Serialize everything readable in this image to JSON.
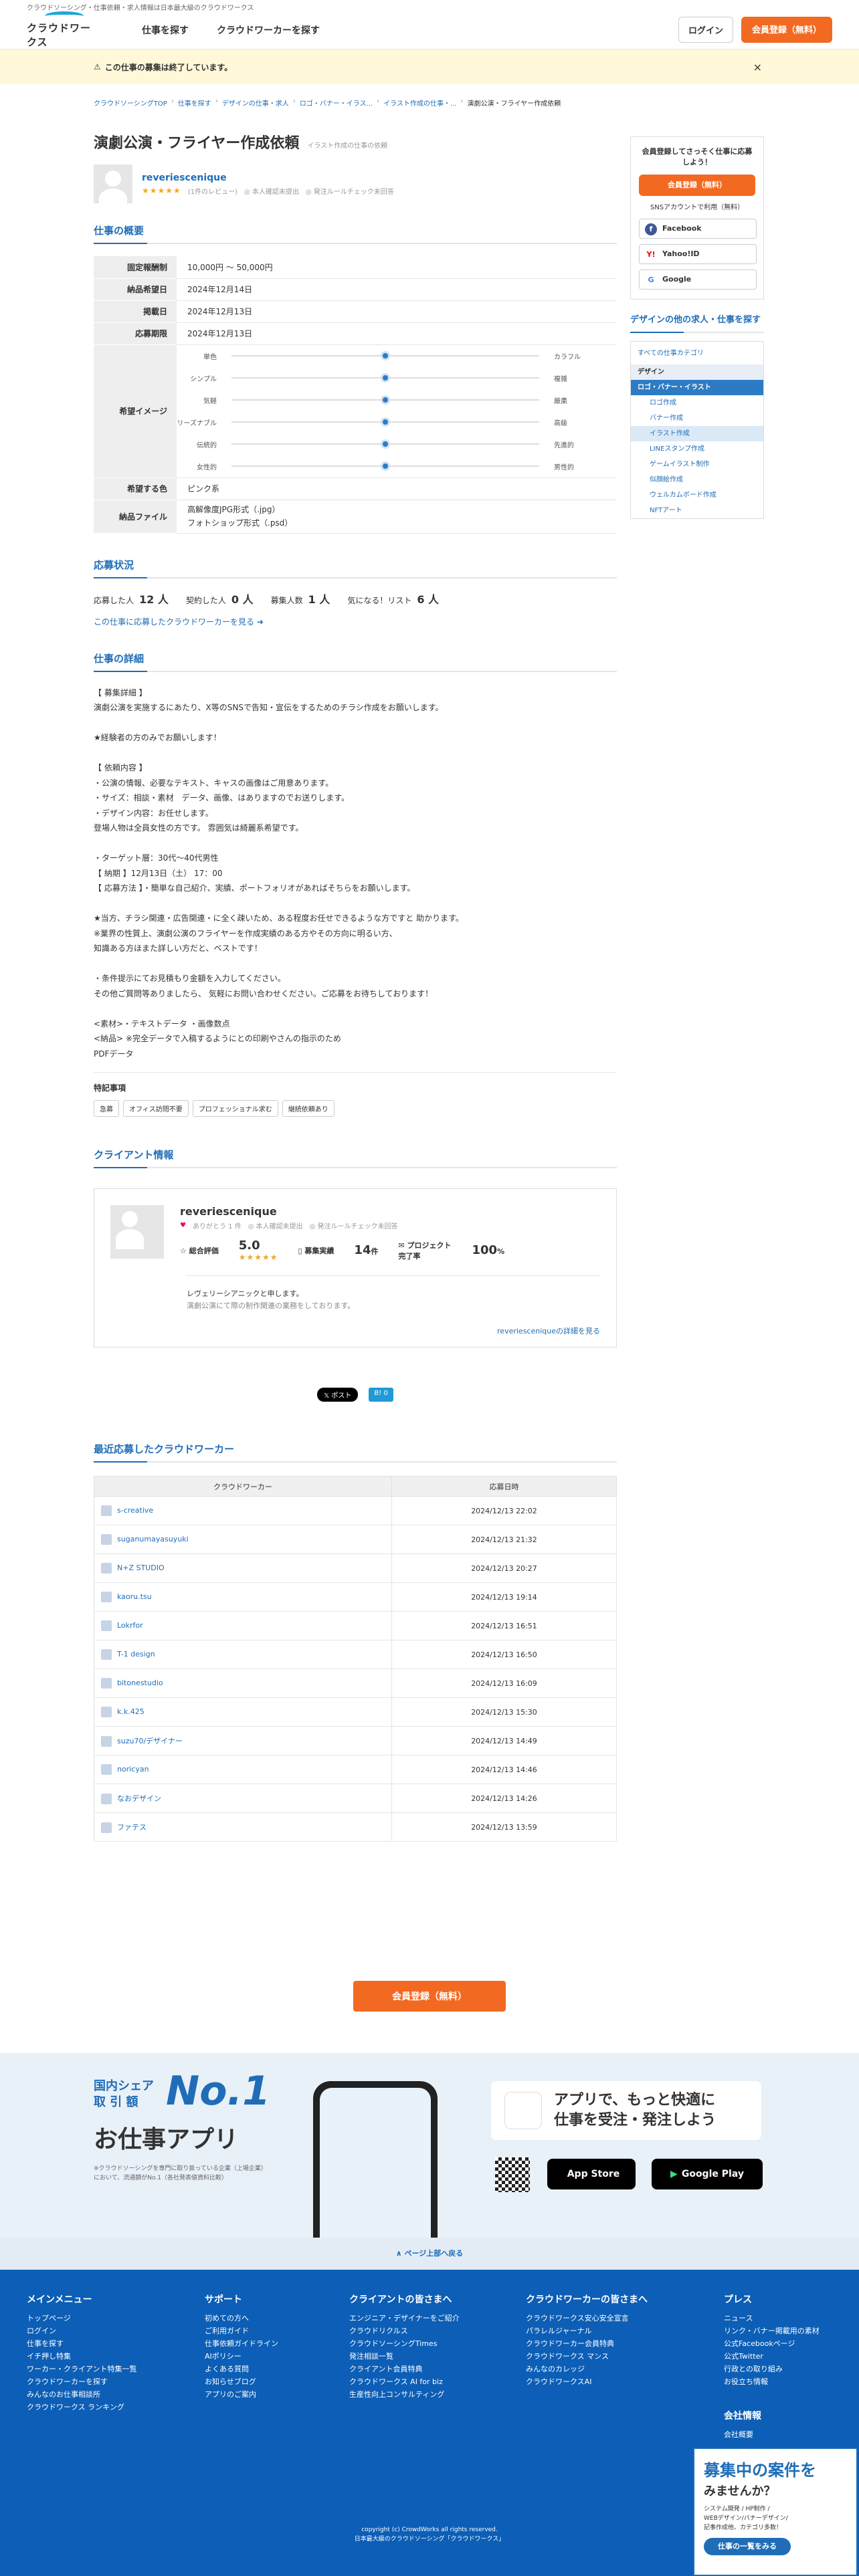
{
  "header": {
    "strip": "クラウドソーシング・仕事依頼・求人情報は日本最大級のクラウドワークス",
    "logo": "クラウドワークス",
    "nav": [
      "仕事を探す",
      "クラウドワーカーを探す"
    ],
    "login": "ログイン",
    "register": "会員登録（無料）"
  },
  "alert": {
    "text": "この仕事の募集は終了しています。",
    "close": "×"
  },
  "breadcrumb": [
    "クラウドソーシングTOP",
    "仕事を探す",
    "デザインの仕事・求人",
    "ロゴ・バナー・イラス...",
    "イラスト作成の仕事・...",
    "演劇公演・フライヤー作成依頼"
  ],
  "job": {
    "title": "演劇公演・フライヤー作成依頼",
    "category_tag": "イラスト作成の仕事の依頼",
    "poster": "reveriescenique",
    "stars": "★★★★★",
    "reviews": "(1件のレビュー)",
    "verify": "本人確認未提出",
    "rule": "発注ルールチェック未回答"
  },
  "overview": {
    "heading": "仕事の概要",
    "rows": [
      {
        "k": "固定報酬制",
        "v": "10,000円 〜 50,000円"
      },
      {
        "k": "納品希望日",
        "v": "2024年12月14日"
      },
      {
        "k": "掲載日",
        "v": "2024年12月13日"
      },
      {
        "k": "応募期限",
        "v": "2024年12月13日"
      }
    ],
    "image_label": "希望イメージ",
    "sliders": [
      {
        "l": "単色",
        "r": "カラフル",
        "pos": 0.5
      },
      {
        "l": "シンプル",
        "r": "複雑",
        "pos": 0.5
      },
      {
        "l": "気軽",
        "r": "厳粛",
        "pos": 0.5
      },
      {
        "l": "リーズナブル",
        "r": "高級",
        "pos": 0.5
      },
      {
        "l": "伝統的",
        "r": "先進的",
        "pos": 0.5
      },
      {
        "l": "女性的",
        "r": "男性的",
        "pos": 0.5
      }
    ],
    "color_label": "希望する色",
    "color": "ピンク系",
    "files_label": "納品ファイル",
    "files1": "高解像度JPG形式（.jpg）",
    "files2": "フォトショップ形式（.psd）"
  },
  "status": {
    "heading": "応募状況",
    "applied_l": "応募した人",
    "applied": "12 人",
    "contracted_l": "契約した人",
    "contracted": "0 人",
    "recruit_l": "募集人数",
    "recruit": "1 人",
    "fav_l": "気になる！リスト",
    "fav": "6 人",
    "link": "この仕事に応募したクラウドワーカーを見る ➜"
  },
  "detail": {
    "heading": "仕事の詳細",
    "body": "【 募集詳細 】\n演劇公演を実施するにあたり、X等のSNSで告知・宣伝をするためのチラシ作成をお願いします。\n\n★経験者の方のみでお願いします！\n\n【 依頼内容 】\n・公演の情報、必要なテキスト、キャスの画像はご用意あります。\n・サイズ：相談・素材　データ、画像、はありますのでお送りします。\n・デザイン内容：お任せします。\n登場人物は全員女性の方です。 雰囲気は綺麗系希望です。\n\n・ターゲット層：30代〜40代男性\n【 納期 】12月13日（土） 17：00\n【 応募方法 】・簡単な自己紹介、実績、ポートフォリオがあればそちらをお願いします。\n\n★当方、チラシ関連・広告関連・に全く疎いため、ある程度お任せできるような方ですと 助かります。\n※業界の性質上、演劇公演のフライヤーを作成実績のある方やその方向に明るい方、\n知識ある方ほまた詳しい方だと、ベストです！\n\n・条件提示にてお見積もり金額を入力してください。\nその他ご質問等ありましたら、 気軽にお問い合わせください。ご応募をお待ちしております！\n\n<素材>・テキストデータ ・画像数点\n<納品> ※完全データで入稿するようにとの印刷やさんの指示のため\nPDFデータ",
    "special_heading": "特記事項",
    "tags": [
      "急募",
      "オフィス訪問不要",
      "プロフェッショナル求む",
      "継続依頼あり"
    ]
  },
  "client": {
    "heading": "クライアント情報",
    "name": "reveriescenique",
    "thanks": "ありがとう 1 件",
    "verify": "本人確認未提出",
    "rule": "発注ルールチェック未回答",
    "rating_l": "総合評価",
    "rating": "5.0",
    "stars": "★★★★★",
    "hires_l": "募集実績",
    "hires": "14",
    "hires_u": "件",
    "done_l": "プロジェクト完了率",
    "done": "100",
    "done_u": "%",
    "msg1": "レヴェリーシアニックと申します。",
    "msg2": "演劇公演にて際の制作関連の業務をしております。",
    "more": "reveriesceniqueの詳細を見る"
  },
  "share": {
    "x": "𝕏 ポスト",
    "b": "B! 0"
  },
  "recent": {
    "heading": "最近応募したクラウドワーカー",
    "col1": "クラウドワーカー",
    "col2": "応募日時",
    "rows": [
      {
        "n": "s-creative",
        "d": "2024/12/13 22:02"
      },
      {
        "n": "suganumayasuyuki",
        "d": "2024/12/13 21:32"
      },
      {
        "n": "N+Z STUDIO",
        "d": "2024/12/13 20:27"
      },
      {
        "n": "kaoru.tsu",
        "d": "2024/12/13 19:14"
      },
      {
        "n": "Lokrfor",
        "d": "2024/12/13 16:51"
      },
      {
        "n": "T-1 design",
        "d": "2024/12/13 16:50"
      },
      {
        "n": "bitonestudio",
        "d": "2024/12/13 16:09"
      },
      {
        "n": "k.k.425",
        "d": "2024/12/13 15:30"
      },
      {
        "n": "suzu70/デザイナー",
        "d": "2024/12/13 14:49"
      },
      {
        "n": "noricyan",
        "d": "2024/12/13 14:46"
      },
      {
        "n": "なおデザイン",
        "d": "2024/12/13 14:26"
      },
      {
        "n": "ファテス",
        "d": "2024/12/13 13:59"
      }
    ]
  },
  "cta": "会員登録（無料）",
  "sidebar": {
    "reg_text": "会員登録してさっそく仕事に応募しよう！",
    "reg_btn": "会員登録（無料）",
    "sns": "SNSアカウントで利用（無料）",
    "fb": "Facebook",
    "yahoo": "Yahoo!ID",
    "google": "Google",
    "other_heading": "デザインの他の求人・仕事を探す",
    "cats": [
      "すべての仕事カテゴリ",
      "デザイン",
      "ロゴ・バナー・イラスト",
      "ロゴ作成",
      "バナー作成",
      "イラスト作成",
      "LINEスタンプ作成",
      "ゲームイラスト制作",
      "似顔絵作成",
      "ウェルカムボード作成",
      "NFTアート"
    ]
  },
  "promo": {
    "share_l1": "国内シェア",
    "share_l2": "取 引 額",
    "no1": "No.1",
    "app": "お仕事アプリ",
    "note": "※クラウドソーシングを専門に取り扱っている企業（上場企業）において、流通額がNo.1（各社発表値資料比較）",
    "tagline1": "アプリで、もっと快適に",
    "tagline2": "仕事を受注・発注しよう",
    "appstore": "App Store",
    "gplay": "Google Play"
  },
  "pagetop": "∧ ページ上部へ戻る",
  "footer": {
    "cols": [
      {
        "h": "メインメニュー",
        "items": [
          "トップページ",
          "ログイン",
          "仕事を探す",
          "イチ押し特集",
          "ワーカー・クライアント特集一覧",
          "クラウドワーカーを探す",
          "みんなのお仕事相談所",
          "クラウドワークス ランキング"
        ]
      },
      {
        "h": "サポート",
        "items": [
          "初めての方へ",
          "ご利用ガイド",
          "仕事依頼ガイドライン",
          "AIポリシー",
          "よくある質問",
          "お知らせブログ",
          "アプリのご案内"
        ]
      },
      {
        "h": "クライアントの皆さまへ",
        "items": [
          "エンジニア・デザイナーをご紹介",
          "クラウドリクルス",
          "クラウドソーシングTimes",
          "発注相談一覧",
          "クライアント会員特典",
          "クラウドワークス AI for biz",
          "生産性向上コンサルティング"
        ]
      },
      {
        "h": "クラウドワーカーの皆さまへ",
        "items": [
          "クラウドワークス安心安全宣言",
          "パラレルジャーナル",
          "クラウドワーカー会員特典",
          "クラウドワークス マンス",
          "みんなのカレッジ",
          "クラウドワークスAI"
        ]
      },
      {
        "h": "プレス",
        "items": [
          "ニュース",
          "リンク・バナー掲載用の素材",
          "公式Facebookページ",
          "公式Twitter",
          "行政との取り組み",
          "お役立ち情報"
        ]
      }
    ],
    "company": "会社情報",
    "company_sub": "会社概要",
    "copy": "copyright (c) CrowdWorks all rights reserved.",
    "copy2": "日本最大級のクラウドソーシング「クラウドワークス」"
  },
  "banner": {
    "t1": "募集中の案件を",
    "t2": "みませんか？",
    "t3": "システム開発 / HP制作 /",
    "t4": "WEBデザイン/バナーデザイン/",
    "t5": "記事作成他、カテゴリ多数！",
    "btn": "仕事の一覧をみる"
  }
}
